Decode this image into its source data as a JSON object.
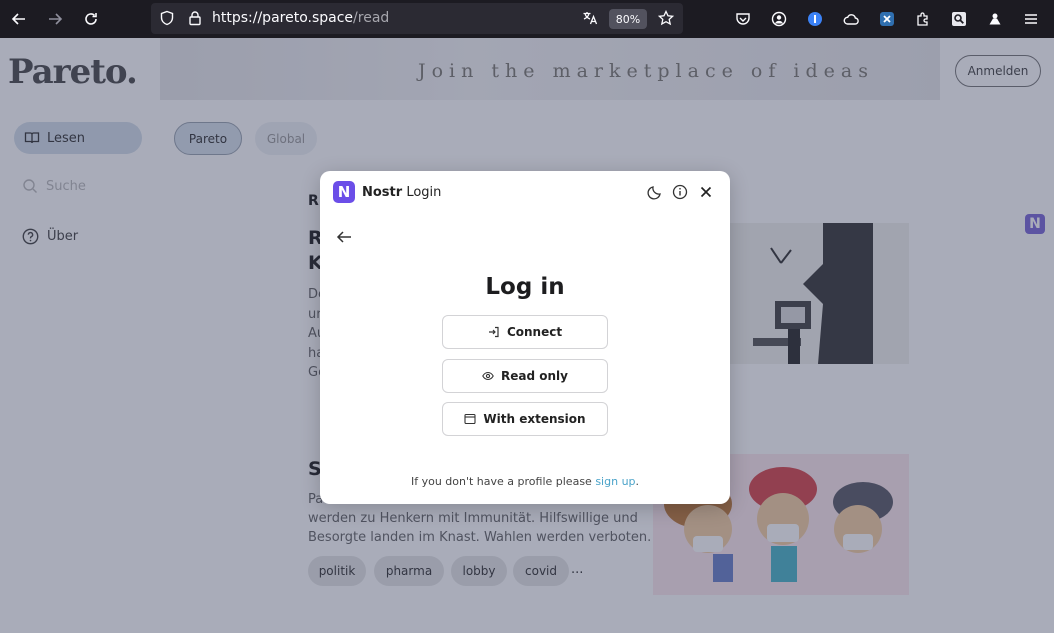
{
  "browser": {
    "url_host": "https://pareto.space",
    "url_path": "/read",
    "zoom": "80%"
  },
  "site": {
    "logo": "Pareto.",
    "banner": "Join the marketplace of ideas",
    "login_button": "Anmelden",
    "sidebar": {
      "read": "Lesen",
      "search_placeholder": "Suche",
      "about": "Über"
    },
    "tabs": [
      "Pareto",
      "Global"
    ],
    "tags": [
      "politik",
      "pharma",
      "lobby",
      "covid"
    ],
    "tags_more": "...",
    "article2_lines": [
      "werden zu Henkern mit Immunität. Hilfswillige und",
      "Besorgte landen im Knast. Wahlen werden verboten."
    ]
  },
  "modal": {
    "brand": "Nostr",
    "title_suffix": "Login",
    "heading": "Log in",
    "buttons": {
      "connect": "Connect",
      "read_only": "Read only",
      "extension": "With extension"
    },
    "footer_prefix": "If you don't have a profile please",
    "footer_link": "sign up",
    "footer_suffix": "."
  },
  "colors": {
    "nostr_purple": "#6b4ee8",
    "link": "#4aa3c9"
  }
}
